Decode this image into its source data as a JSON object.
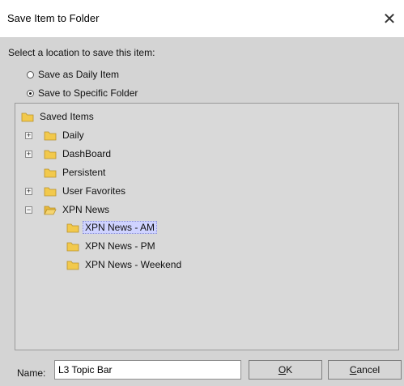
{
  "window": {
    "title": "Save Item to Folder",
    "close_glyph": "✕"
  },
  "location": {
    "prompt": "Select a location to save this item:",
    "options": [
      {
        "label": "Save as Daily Item",
        "checked": false
      },
      {
        "label": "Save to Specific Folder",
        "checked": true
      }
    ]
  },
  "tree": {
    "root": "Saved Items",
    "items": [
      {
        "label": "Daily",
        "expander": "+",
        "icon": "folder-icon"
      },
      {
        "label": "DashBoard",
        "expander": "+",
        "icon": "folder-icon"
      },
      {
        "label": "Persistent",
        "expander": "",
        "icon": "folder-icon"
      },
      {
        "label": "User Favorites",
        "expander": "+",
        "icon": "folder-icon"
      },
      {
        "label": "XPN News",
        "expander": "−",
        "icon": "open-folder-icon"
      }
    ],
    "children": [
      {
        "label": "XPN News - AM",
        "selected": true
      },
      {
        "label": "XPN News - PM",
        "selected": false
      },
      {
        "label": "XPN News - Weekend",
        "selected": false
      }
    ]
  },
  "footer": {
    "name_label": "Name:",
    "name_value": "L3 Topic Bar",
    "ok_label": "OK",
    "cancel_label": "Cancel"
  },
  "colors": {
    "folder": "#f2c94c",
    "selection": "#cfd3ff"
  }
}
